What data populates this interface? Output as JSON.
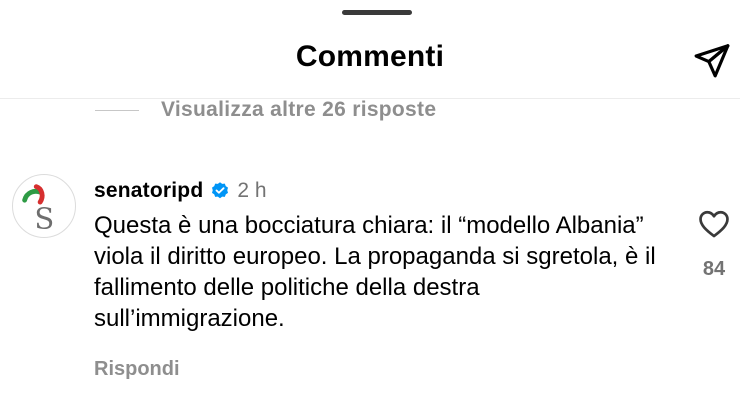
{
  "header": {
    "title": "Commenti",
    "share_icon": "paper-plane-icon"
  },
  "thread": {
    "view_more_label": "Visualizza altre 26 risposte"
  },
  "comment": {
    "username": "senatoripd",
    "verified": true,
    "timestamp": "2 h",
    "text": "Questa è una bocciatura chiara: il “modello Albania” viola il diritto europeo. La propaganda si sgretola, è il fallimento delle politiche della destra sull’immigrazione.",
    "reply_label": "Rispondi",
    "like_count": "84",
    "like_icon": "heart-outline-icon",
    "avatar": {
      "letter": "S",
      "colors": {
        "green": "#2e9b45",
        "red": "#d62f2f",
        "letter": "#6e6e6e"
      }
    }
  },
  "colors": {
    "verified_blue": "#0095f6",
    "muted_text": "#8e8e8e",
    "secondary_text": "#737373"
  }
}
